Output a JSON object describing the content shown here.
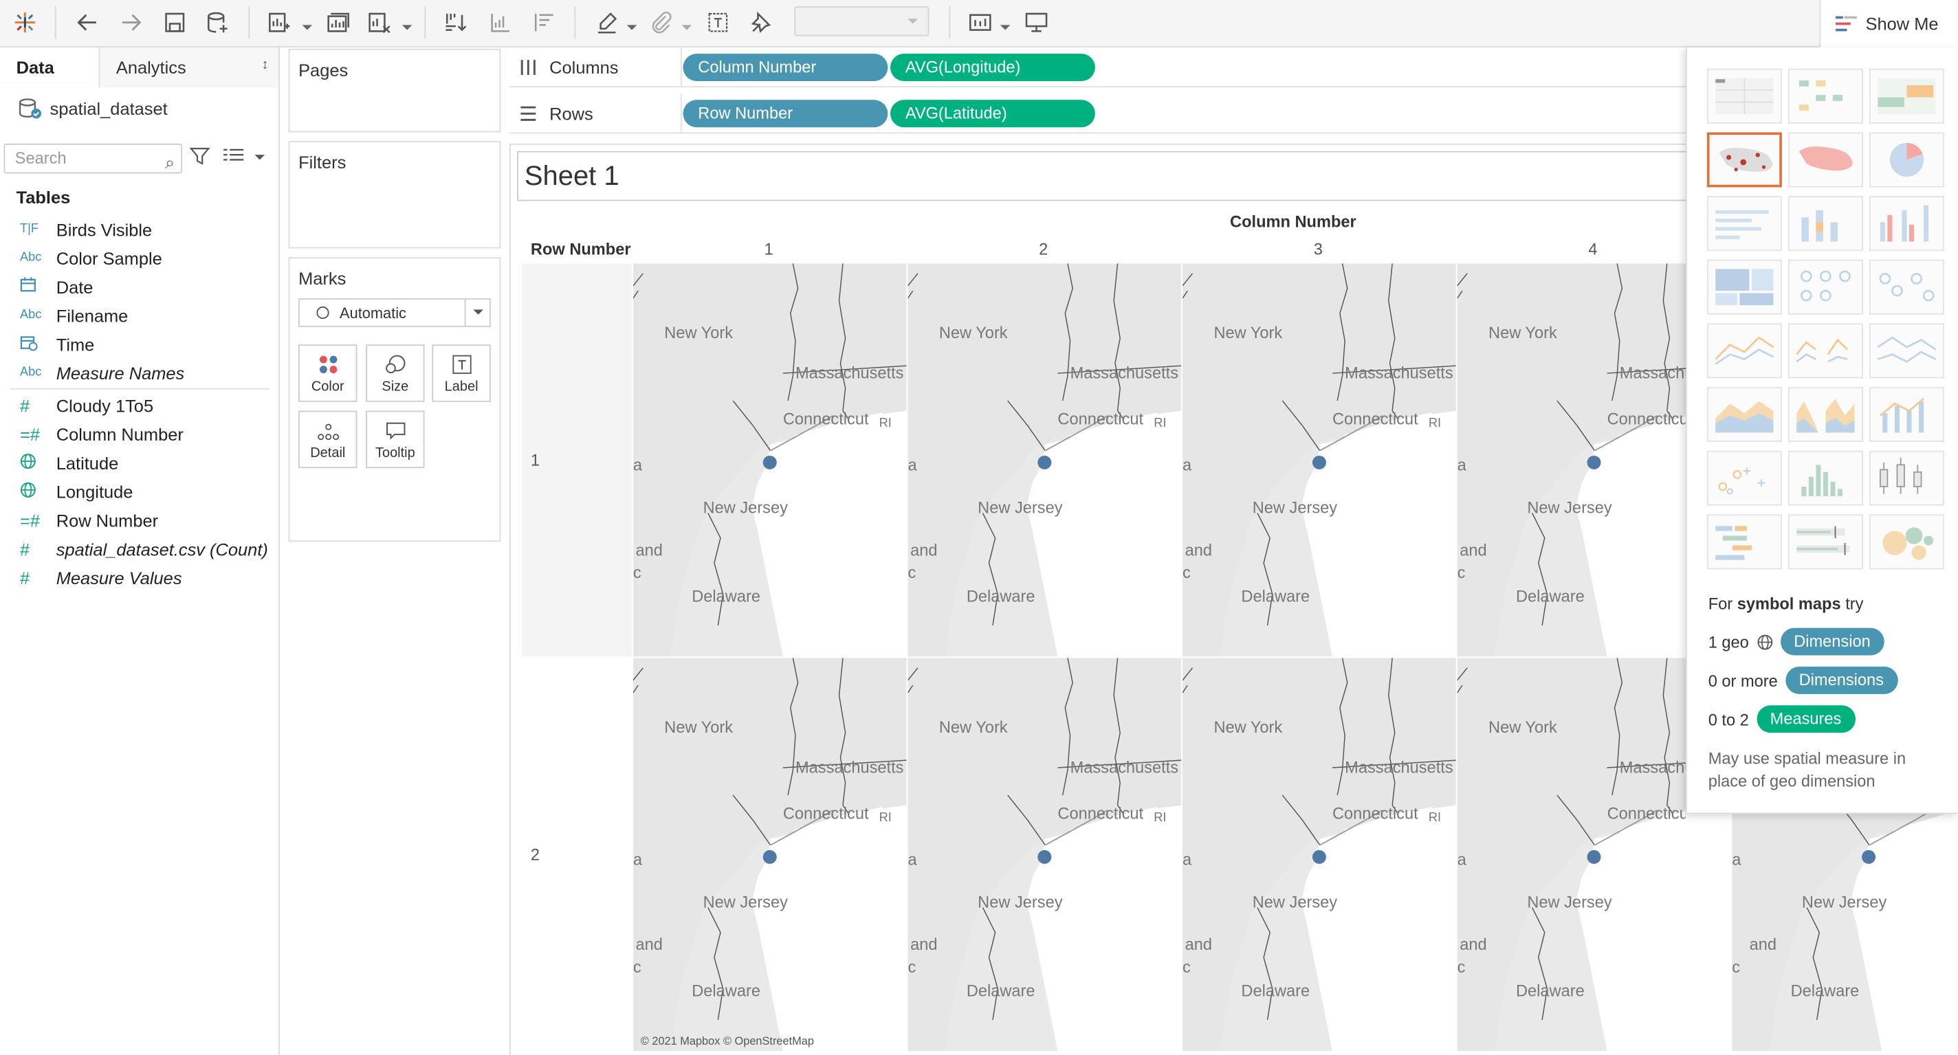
{
  "toolbar": {
    "show_me_label": "Show Me"
  },
  "data_pane": {
    "tab_data": "Data",
    "tab_analytics": "Analytics",
    "datasource": "spatial_dataset",
    "search_placeholder": "Search",
    "tables_header": "Tables",
    "fields": [
      {
        "icon": "T|F",
        "label": "Birds Visible",
        "kind": "dim"
      },
      {
        "icon": "Abc",
        "label": "Color Sample",
        "kind": "dim"
      },
      {
        "icon": "calendar",
        "label": "Date",
        "kind": "dim"
      },
      {
        "icon": "Abc",
        "label": "Filename",
        "kind": "dim"
      },
      {
        "icon": "calendar-time",
        "label": "Time",
        "kind": "dim"
      },
      {
        "icon": "Abc",
        "label": "Measure Names",
        "kind": "dim",
        "italic": true
      },
      {
        "icon": "#",
        "label": "Cloudy 1To5",
        "kind": "meas"
      },
      {
        "icon": "=#",
        "label": "Column Number",
        "kind": "meas"
      },
      {
        "icon": "globe",
        "label": "Latitude",
        "kind": "meas"
      },
      {
        "icon": "globe",
        "label": "Longitude",
        "kind": "meas"
      },
      {
        "icon": "=#",
        "label": "Row Number",
        "kind": "meas"
      },
      {
        "icon": "#",
        "label": "spatial_dataset.csv (Count)",
        "kind": "meas",
        "italic": true
      },
      {
        "icon": "#",
        "label": "Measure Values",
        "kind": "meas",
        "italic": true
      }
    ]
  },
  "cards": {
    "pages": "Pages",
    "filters": "Filters",
    "marks": "Marks",
    "mark_type": "Automatic",
    "mark_buttons": [
      "Color",
      "Size",
      "Label",
      "Detail",
      "Tooltip"
    ]
  },
  "shelves": {
    "columns_label": "Columns",
    "rows_label": "Rows",
    "columns_pills": [
      "Column Number",
      "AVG(Longitude)"
    ],
    "rows_pills": [
      "Row Number",
      "AVG(Latitude)"
    ]
  },
  "viz": {
    "sheet_title": "Sheet 1",
    "column_header": "Column Number",
    "row_header": "Row Number",
    "column_values": [
      "1",
      "2",
      "3",
      "4"
    ],
    "row_values": [
      "1",
      "2"
    ],
    "map_labels": [
      "New York",
      "Massachusetts",
      "Connecticut",
      "RI",
      "New Jersey",
      "and",
      "Delaware",
      "a",
      "c"
    ],
    "attribution": "© 2021 Mapbox © OpenStreetMap"
  },
  "show_me": {
    "hint_prefix": "For",
    "hint_bold": "symbol maps",
    "hint_suffix": "try",
    "req1_prefix": "1 geo",
    "req1_pill": "Dimension",
    "req2_prefix": "0 or more",
    "req2_pill": "Dimensions",
    "req3_prefix": "0 to 2",
    "req3_pill": "Measures",
    "note": "May use spatial measure in place of geo dimension"
  }
}
